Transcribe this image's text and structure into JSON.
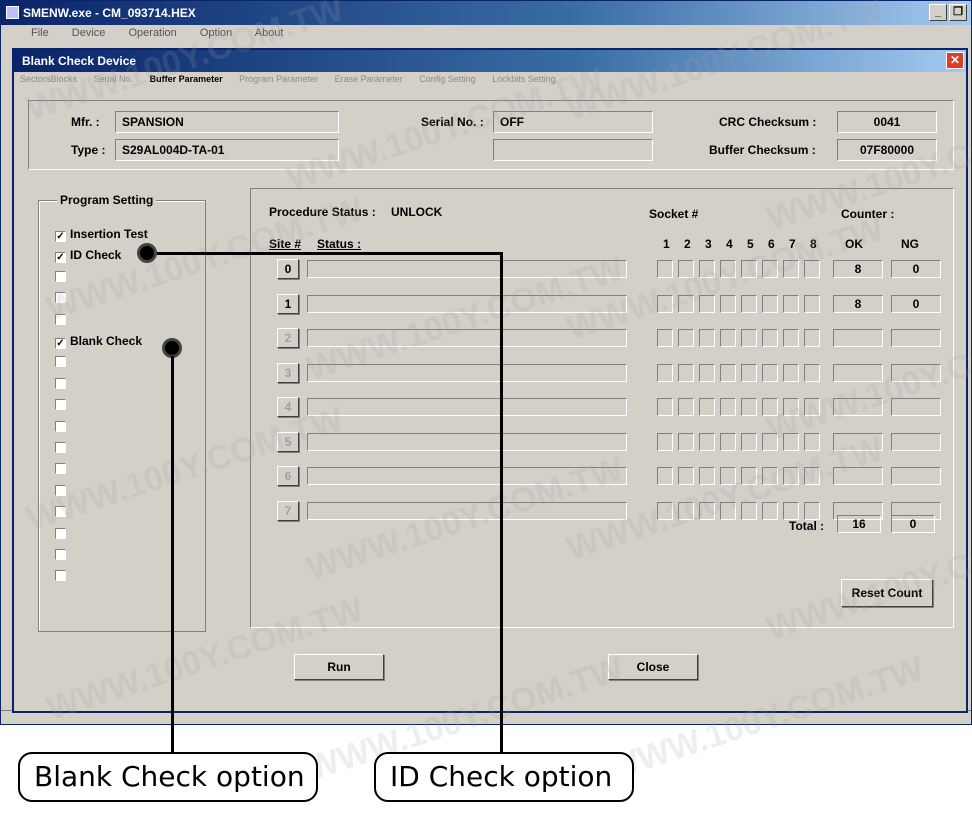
{
  "outer_window": {
    "title": "SMENW.exe - CM_093714.HEX",
    "menu": [
      "File",
      "Device",
      "Operation",
      "Option",
      "About"
    ]
  },
  "dialog": {
    "title": "Blank Check Device",
    "tabs": [
      "SectorsBlocks",
      "Serial No.",
      "Buffer Parameter",
      "Program Parameter",
      "Erase Parameter",
      "Config Setting",
      "Lockbits Setting"
    ],
    "active_tab": "Buffer Parameter"
  },
  "info": {
    "mfr_label": "Mfr. :",
    "mfr_value": "SPANSION",
    "type_label": "Type :",
    "type_value": "S29AL004D-TA-01",
    "serial_label": "Serial No. :",
    "serial_value": "OFF",
    "crc_label": "CRC Checksum :",
    "crc_value": "0041",
    "buffer_label": "Buffer Checksum :",
    "buffer_value": "07F80000"
  },
  "program_setting": {
    "title": "Program Setting",
    "options": [
      {
        "label": "Insertion Test",
        "checked": "true"
      },
      {
        "label": "ID Check",
        "checked": "true"
      },
      {
        "label": "",
        "checked": "false"
      },
      {
        "label": "",
        "checked": "false"
      },
      {
        "label": "",
        "checked": "false"
      },
      {
        "label": "Blank Check",
        "checked": "true"
      },
      {
        "label": "",
        "checked": "false"
      },
      {
        "label": "",
        "checked": "false"
      },
      {
        "label": "",
        "checked": "false"
      },
      {
        "label": "",
        "checked": "false"
      },
      {
        "label": "",
        "checked": "false"
      },
      {
        "label": "",
        "checked": "false"
      },
      {
        "label": "",
        "checked": "false"
      },
      {
        "label": "",
        "checked": "false"
      },
      {
        "label": "",
        "checked": "false"
      },
      {
        "label": "",
        "checked": "false"
      },
      {
        "label": "",
        "checked": "false"
      }
    ]
  },
  "procedure": {
    "status_label": "Procedure Status :",
    "status_value": "UNLOCK",
    "site_header": "Site #",
    "status_header": "Status :",
    "socket_header": "Socket #",
    "socket_numbers": [
      "1",
      "2",
      "3",
      "4",
      "5",
      "6",
      "7",
      "8"
    ],
    "counter_header": "Counter :",
    "ok_header": "OK",
    "ng_header": "NG",
    "sites": [
      {
        "site": "0",
        "ok": "8",
        "ng": "0"
      },
      {
        "site": "1",
        "ok": "8",
        "ng": "0"
      },
      {
        "site": "2",
        "ok": "",
        "ng": ""
      },
      {
        "site": "3",
        "ok": "",
        "ng": ""
      },
      {
        "site": "4",
        "ok": "",
        "ng": ""
      },
      {
        "site": "5",
        "ok": "",
        "ng": ""
      },
      {
        "site": "6",
        "ok": "",
        "ng": ""
      },
      {
        "site": "7",
        "ok": "",
        "ng": ""
      }
    ],
    "total_label": "Total :",
    "total_ok": "16",
    "total_ng": "0",
    "reset_label": "Reset Count"
  },
  "buttons": {
    "run": "Run",
    "close": "Close"
  },
  "callouts": {
    "blank_check": "Blank Check option",
    "id_check": "ID Check option"
  },
  "watermark_text": "WWW.100Y.COM.TW"
}
